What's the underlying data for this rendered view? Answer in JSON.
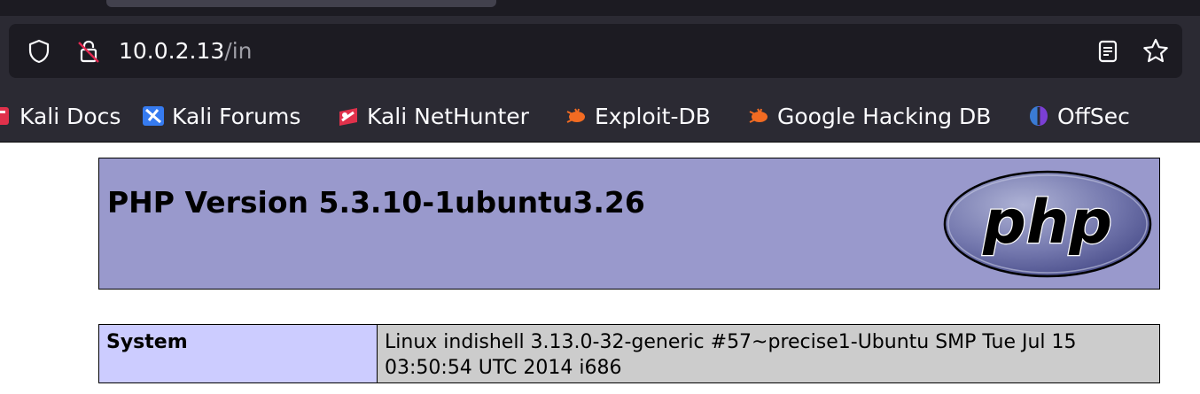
{
  "browser": {
    "url_host": "10.0.2.13",
    "url_path": "/in",
    "bookmarks": [
      {
        "label": "Kali Docs",
        "icon": "kali-docs-icon"
      },
      {
        "label": "Kali Forums",
        "icon": "kali-forums-icon"
      },
      {
        "label": "Kali NetHunter",
        "icon": "kali-nethunter-icon"
      },
      {
        "label": "Exploit-DB",
        "icon": "exploit-db-icon"
      },
      {
        "label": "Google Hacking DB",
        "icon": "exploit-db-icon"
      },
      {
        "label": "OffSec",
        "icon": "offsec-icon"
      }
    ]
  },
  "phpinfo": {
    "title": "PHP Version 5.3.10-1ubuntu3.26",
    "logo_text": "php",
    "rows": [
      {
        "label": "System",
        "value": "Linux indishell 3.13.0-32-generic #57~precise1-Ubuntu SMP Tue Jul 15 03:50:54 UTC 2014 i686"
      }
    ]
  },
  "colors": {
    "header_bg": "#9999cc",
    "label_bg": "#ccccff",
    "value_bg": "#cccccc",
    "chrome_bg": "#2b2a33"
  }
}
